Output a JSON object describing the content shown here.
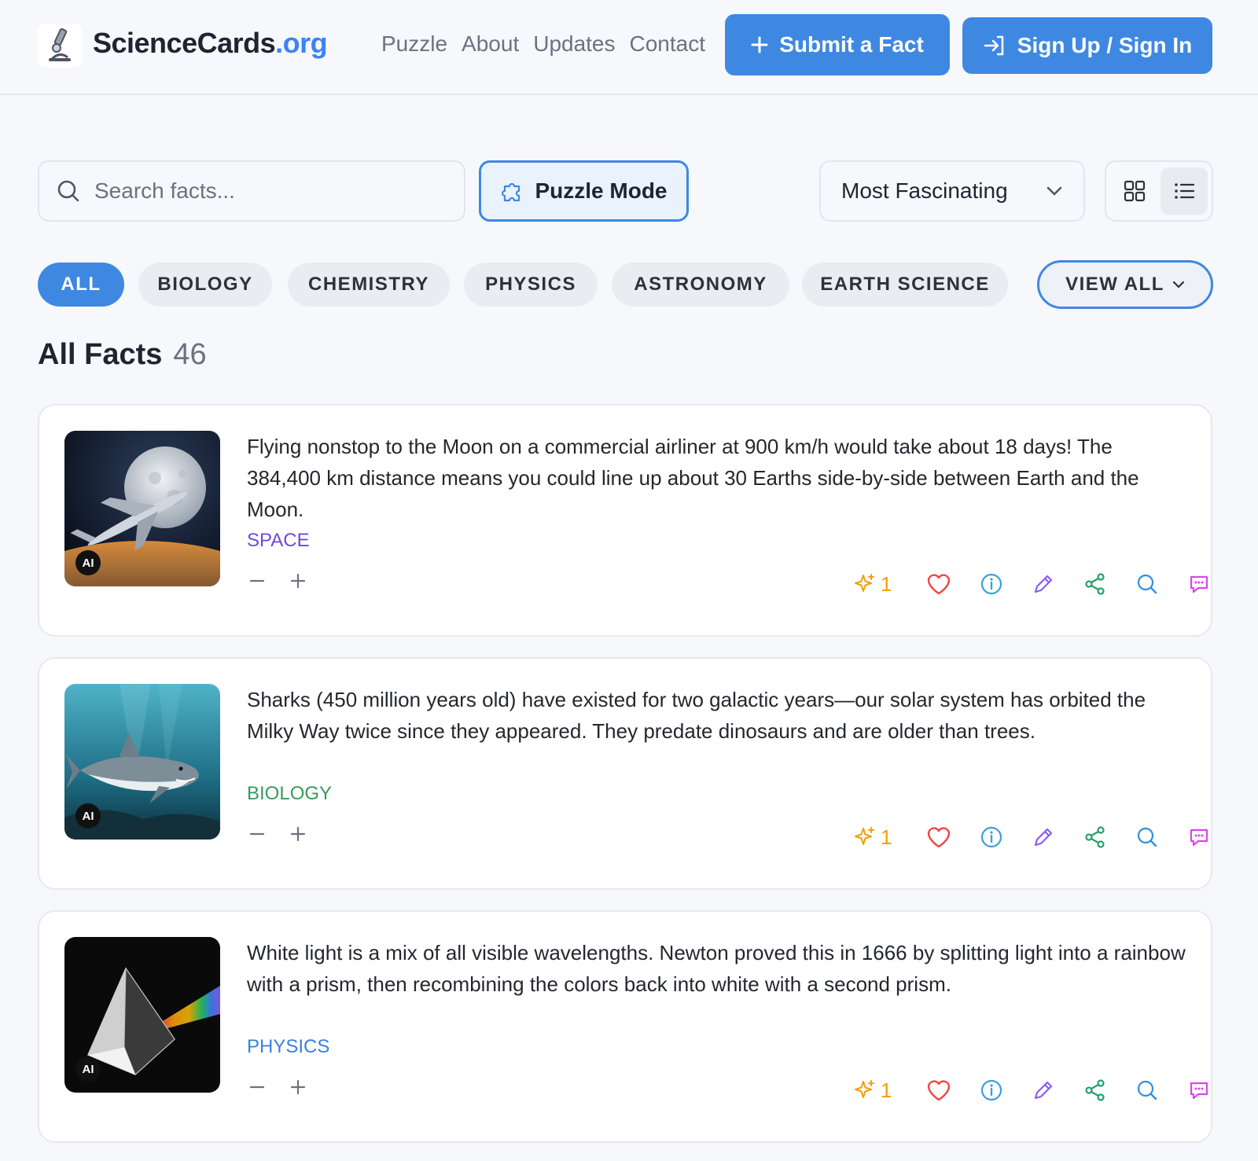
{
  "header": {
    "brand_main": "ScienceCards",
    "brand_tld": ".org",
    "nav": [
      "Puzzle",
      "About",
      "Updates",
      "Contact"
    ],
    "submit_label": "Submit a Fact",
    "signin_label": "Sign Up / Sign In"
  },
  "toolbar": {
    "search_placeholder": "Search facts...",
    "puzzle_label": "Puzzle Mode",
    "sort_selected": "Most Fascinating"
  },
  "filters": {
    "items": [
      "ALL",
      "BIOLOGY",
      "CHEMISTRY",
      "PHYSICS",
      "ASTRONOMY",
      "EARTH SCIENCE"
    ],
    "active": "ALL",
    "view_all_label": "VIEW ALL"
  },
  "list": {
    "title": "All Facts",
    "count": "46"
  },
  "cards": [
    {
      "text": "Flying nonstop to the Moon on a commercial airliner at 900 km/h would take about 18 days! The 384,400 km distance means you could line up about 30 Earths side-by-side between Earth and the Moon.",
      "category": "SPACE",
      "category_color": "#6d4ae0",
      "badge": "AI",
      "fascinating_count": "1",
      "image": "moon-airplane"
    },
    {
      "text": "Sharks (450 million years old) have existed for two galactic years—our solar system has orbited the Milky Way twice since they appeared. They predate dinosaurs and are older than trees.",
      "category": "BIOLOGY",
      "category_color": "#3a9a5b",
      "badge": "AI",
      "fascinating_count": "1",
      "image": "shark"
    },
    {
      "text": "White light is a mix of all visible wavelengths. Newton proved this in 1666 by splitting light into a rainbow with a prism, then recombining the colors back into white with a second prism.",
      "category": "PHYSICS",
      "category_color": "#3b7fe0",
      "badge": "AI",
      "fascinating_count": "1",
      "image": "prism"
    }
  ],
  "colors": {
    "accent": "#3f88e2",
    "star": "#f59e0b",
    "heart": "#ef4444",
    "info": "#3b9ee0",
    "edit": "#8b5cf6",
    "share": "#22a06b",
    "search": "#2f8fe0",
    "comment": "#d946ef"
  }
}
